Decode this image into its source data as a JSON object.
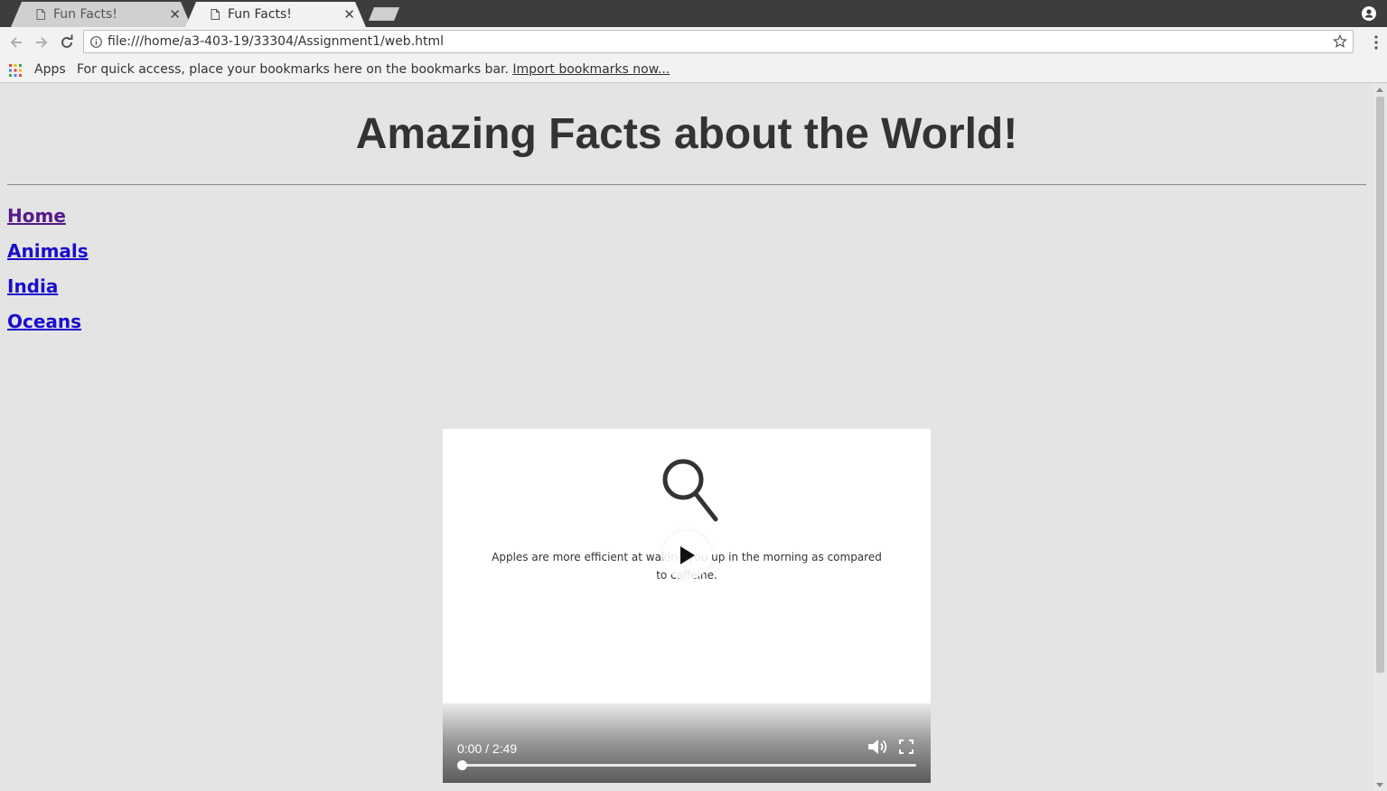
{
  "browser": {
    "tabs": [
      {
        "title": "Fun Facts!",
        "active": false
      },
      {
        "title": "Fun Facts!",
        "active": true
      }
    ],
    "url": "file:///home/a3-403-19/33304/Assignment1/web.html",
    "bookmarks_bar": {
      "apps_label": "Apps",
      "message": "For quick access, place your bookmarks here on the bookmarks bar.",
      "import_link": "Import bookmarks now..."
    }
  },
  "page": {
    "heading": "Amazing Facts about the World!",
    "nav": [
      {
        "label": "Home",
        "visited": true
      },
      {
        "label": "Animals",
        "visited": false
      },
      {
        "label": "India",
        "visited": false
      },
      {
        "label": "Oceans",
        "visited": false
      }
    ],
    "video": {
      "caption": "Apples are more efficient at waking you up in the morning as compared to caffeine.",
      "time": "0:00 / 2:49",
      "progress": 0
    }
  },
  "colors": {
    "link": "#1a0dcc",
    "visited_link": "#551a8b",
    "page_background": "#e4e4e4",
    "heading": "#333333"
  },
  "icons": {
    "back": "arrow-left-icon",
    "forward": "arrow-right-icon",
    "reload": "reload-icon",
    "info": "info-icon",
    "bookmark_star": "star-icon",
    "menu": "kebab-menu-icon",
    "apps": "apps-grid-icon",
    "profile": "profile-icon",
    "tab_page": "page-icon",
    "tab_close": "close-icon",
    "video_poster": "magnifier-icon",
    "play": "play-icon",
    "mute": "volume-icon",
    "fullscreen": "fullscreen-icon"
  }
}
